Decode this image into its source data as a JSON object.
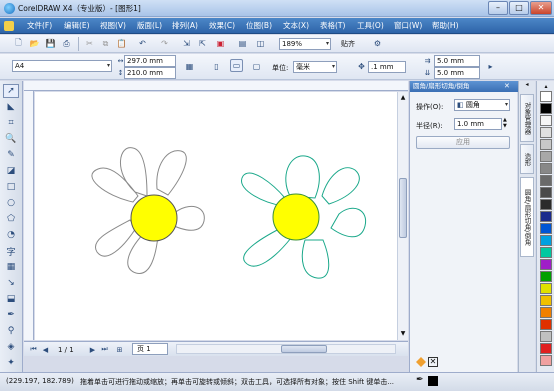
{
  "window": {
    "title": "CorelDRAW X4（专业版）- [图形1]",
    "minimize": "–",
    "maximize": "□",
    "close": "✕"
  },
  "menu": [
    "文件(F)",
    "编辑(E)",
    "视图(V)",
    "版面(L)",
    "排列(A)",
    "效果(C)",
    "位图(B)",
    "文本(X)",
    "表格(T)",
    "工具(O)",
    "窗口(W)",
    "帮助(H)"
  ],
  "toolbar": {
    "zoom": "189%",
    "snap": "贴齐"
  },
  "propbar": {
    "page_size": "A4",
    "width": "297.0 mm",
    "height": "210.0 mm",
    "units_label": "单位:",
    "units": "毫米",
    "nudge": ".1 mm",
    "dup_x": "5.0 mm",
    "dup_y": "5.0 mm"
  },
  "docker": {
    "title": "圆角/扇形切角/倒角",
    "operation_label": "操作(O):",
    "operation_value": "圆角",
    "radius_label": "半径(R):",
    "radius_value": "1.0 mm",
    "apply": "应用"
  },
  "sidetabs": [
    "对象管理器",
    "造形",
    "圆角/扇形切角/倒角"
  ],
  "canvas": {
    "page_counter": "1 / 1",
    "page_tab": "页 1",
    "flowers": [
      {
        "petal_color": "#8a8a8a",
        "center_color": "#ffff00"
      },
      {
        "petal_color": "#1aa88a",
        "center_color": "#ffff00"
      }
    ]
  },
  "palette": [
    "#ffffff",
    "#000000",
    "#f5f5f5",
    "#e0e0e0",
    "#c8c8c8",
    "#a8a8a8",
    "#888888",
    "#6a6a6a",
    "#4a4a4a",
    "#2b2b2b",
    "#1a2a8c",
    "#0055d4",
    "#00a0e0",
    "#00c8a0",
    "#a01ec8",
    "#00a000",
    "#e0e000",
    "#f0c000",
    "#f08000",
    "#e03000",
    "#c0c0c0",
    "#e02020",
    "#f0a0a0"
  ],
  "status": {
    "coords": "(229.197, 182.789)",
    "message": "拖着单击可进行拖动或缩放；再单击可旋转或倾斜；双击工具，可选择所有对象；按住 Shift 键单击..."
  }
}
